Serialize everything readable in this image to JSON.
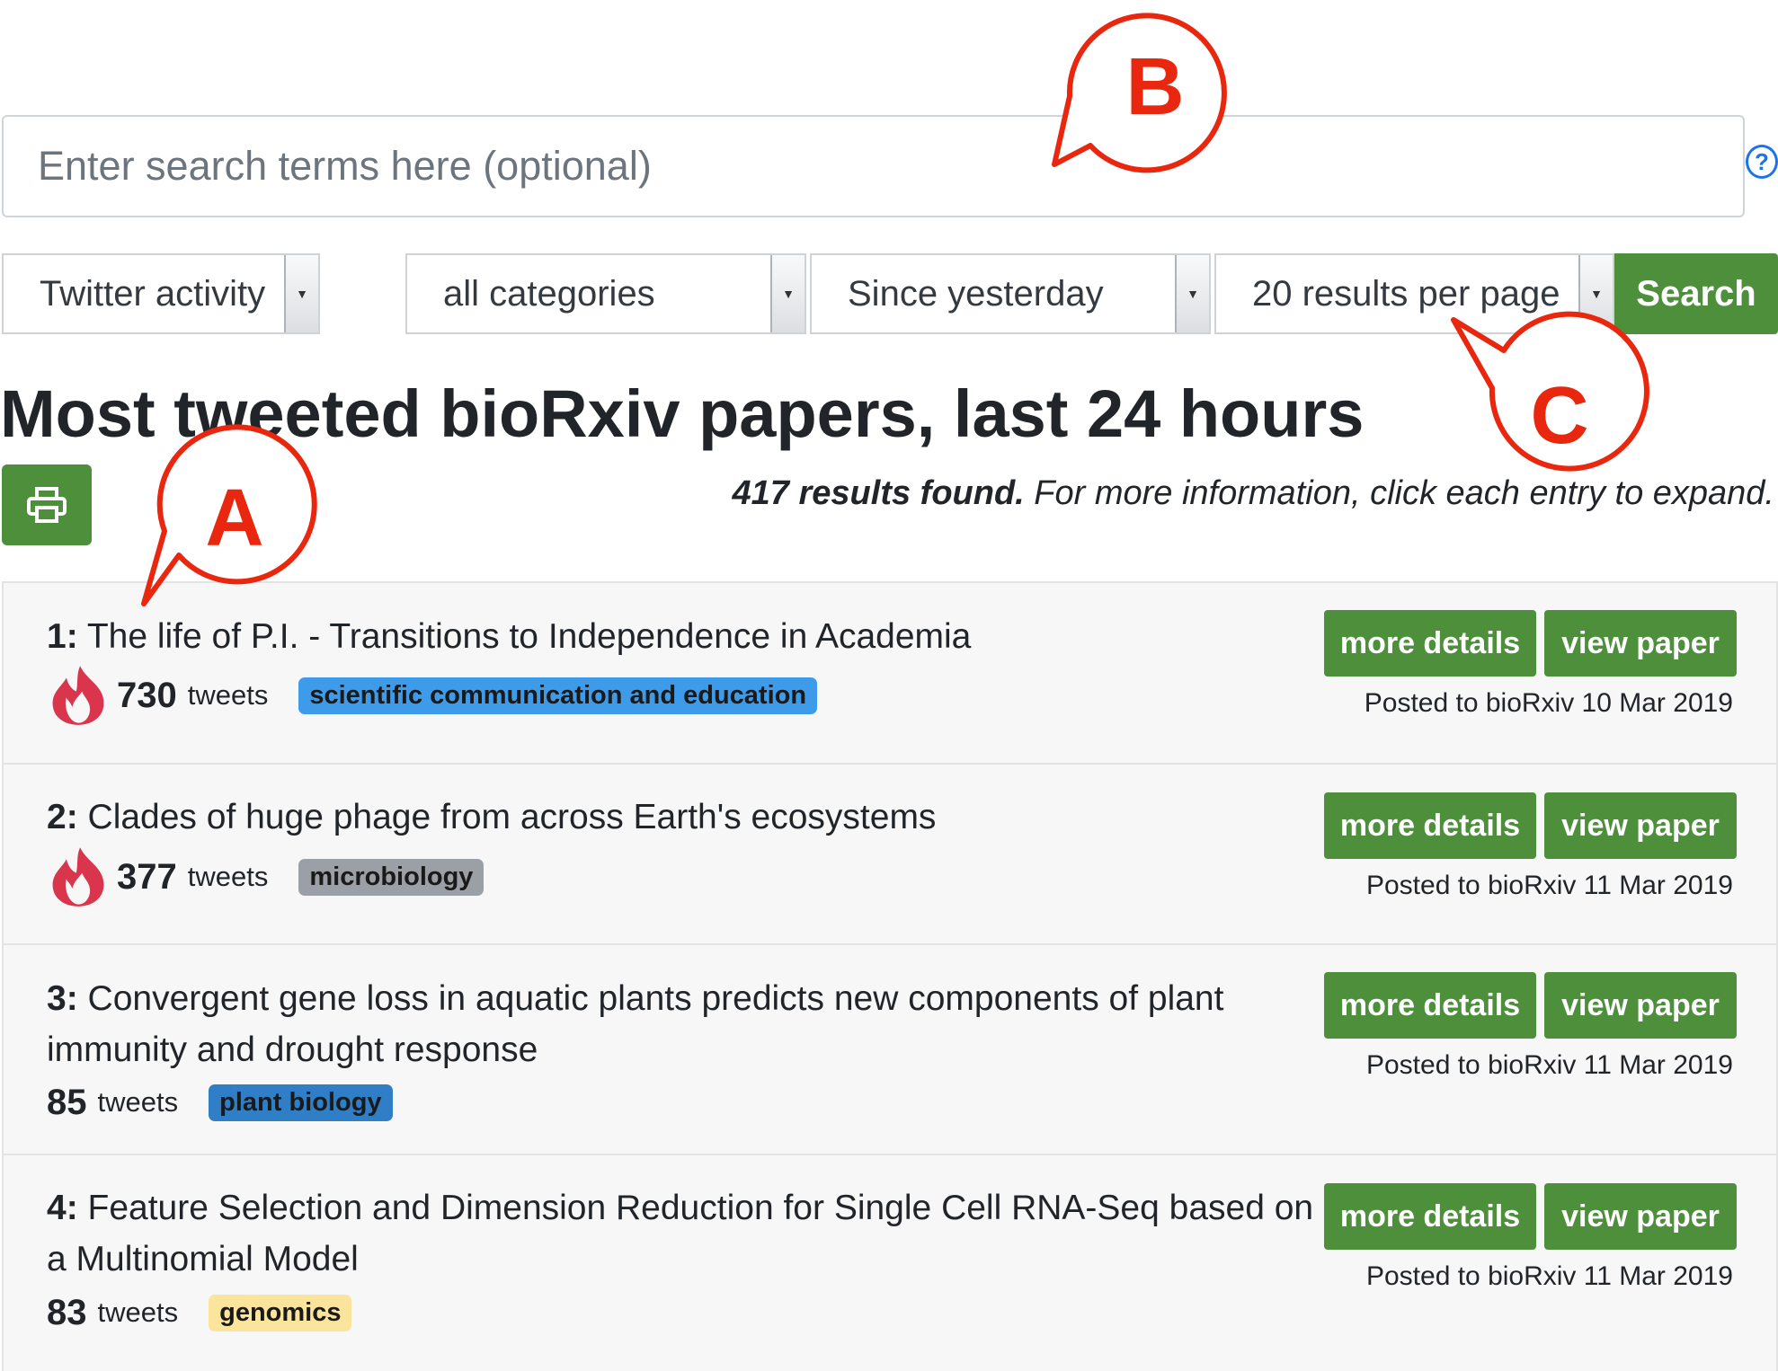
{
  "search": {
    "placeholder": "Enter search terms here (optional)",
    "help_icon": "question-circle-icon",
    "help_glyph": "?"
  },
  "filters": {
    "sort": "Twitter activity",
    "category": "all categories",
    "timeframe": "Since yesterday",
    "per_page": "20 results per page",
    "search_button": "Search"
  },
  "page_title": "Most tweeted bioRxiv papers, last 24 hours",
  "print_icon": "printer-icon",
  "results_info": {
    "count": "417 results found.",
    "text": " For more information, click each entry to expand."
  },
  "buttons": {
    "details": "more details",
    "view": "view paper"
  },
  "results": [
    {
      "rank": "1:",
      "title": " The life of P.I. - Transitions to Independence in Academia",
      "tweets": "730",
      "tweets_label": "tweets",
      "category": "scientific communication and education",
      "category_color": "#3d9be9",
      "posted": "Posted to bioRxiv 10 Mar 2019",
      "hot": true
    },
    {
      "rank": "2:",
      "title": " Clades of huge phage from across Earth's ecosystems",
      "tweets": "377",
      "tweets_label": "tweets",
      "category": "microbiology",
      "category_color": "#9aa0a6",
      "posted": "Posted to bioRxiv 11 Mar 2019",
      "hot": true
    },
    {
      "rank": "3:",
      "title": " Convergent gene loss in aquatic plants predicts new components of plant immunity and drought response",
      "tweets": "85",
      "tweets_label": "tweets",
      "category": "plant biology",
      "category_color": "#2f7ec6",
      "posted": "Posted to bioRxiv 11 Mar 2019",
      "hot": false
    },
    {
      "rank": "4:",
      "title": " Feature Selection and Dimension Reduction for Single Cell RNA-Seq based on a Multinomial Model",
      "tweets": "83",
      "tweets_label": "tweets",
      "category": "genomics",
      "category_color": "#fbe49b",
      "posted": "Posted to bioRxiv 11 Mar 2019",
      "hot": false
    }
  ],
  "annotations": {
    "a": "A",
    "b": "B",
    "c": "C"
  },
  "colors": {
    "accent_green": "#4e8f3c",
    "annotation_red": "#e8270e",
    "flame_red": "#d9364d"
  }
}
